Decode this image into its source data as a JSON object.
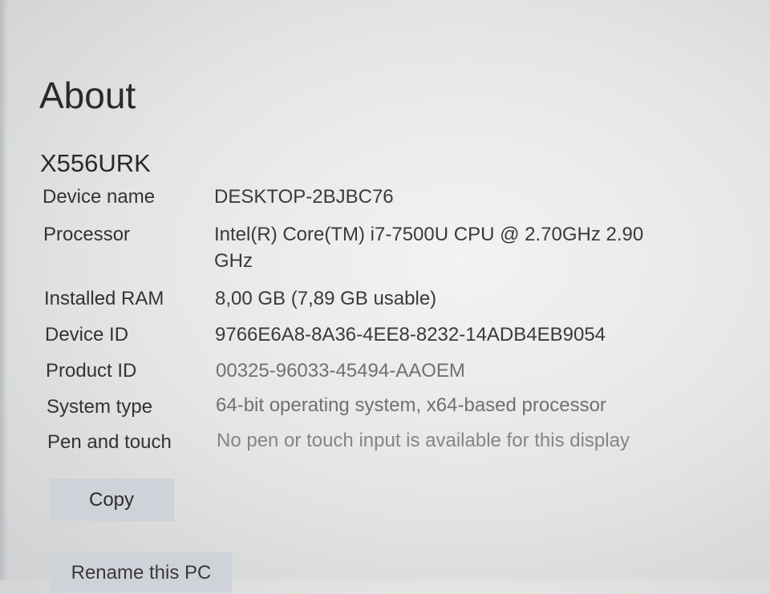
{
  "page": {
    "title": "About"
  },
  "device": {
    "model": "X556URK"
  },
  "specs": [
    {
      "label": "Device name",
      "value": "DESKTOP-2BJBC76"
    },
    {
      "label": "Processor",
      "value": "Intel(R) Core(TM) i7-7500U CPU @ 2.70GHz   2.90 GHz"
    },
    {
      "label": "Installed RAM",
      "value": "8,00 GB (7,89 GB usable)"
    },
    {
      "label": "Device ID",
      "value": "9766E6A8-8A36-4EE8-8232-14ADB4EB9054"
    },
    {
      "label": "Product ID",
      "value": "00325-96033-45494-AAOEM"
    },
    {
      "label": "System type",
      "value": "64-bit operating system, x64-based processor"
    },
    {
      "label": "Pen and touch",
      "value": "No pen or touch input is available for this display"
    }
  ],
  "actions": {
    "copy_label": "Copy",
    "rename_label": "Rename this PC"
  }
}
